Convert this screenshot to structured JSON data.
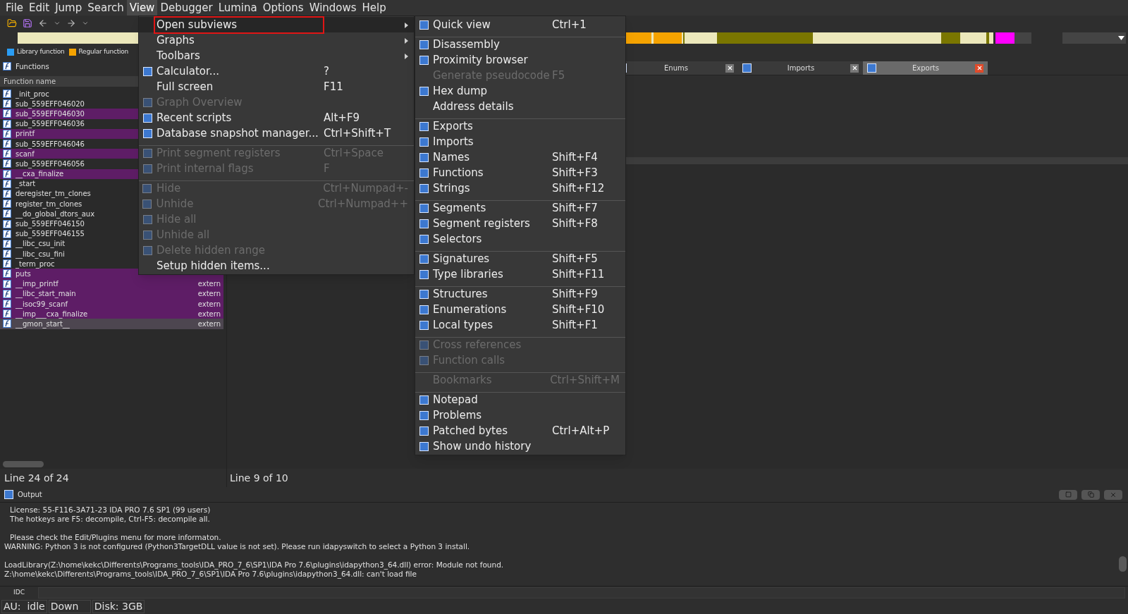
{
  "menubar": [
    {
      "label": "File",
      "selected": false
    },
    {
      "label": "Edit",
      "selected": false
    },
    {
      "label": "Jump",
      "selected": false
    },
    {
      "label": "Search",
      "selected": false
    },
    {
      "label": "View",
      "selected": true
    },
    {
      "label": "Debugger",
      "selected": false
    },
    {
      "label": "Lumina",
      "selected": false
    },
    {
      "label": "Options",
      "selected": false
    },
    {
      "label": "Windows",
      "selected": false
    },
    {
      "label": "Help",
      "selected": false
    }
  ],
  "legend": [
    {
      "label": "Library function",
      "color": "#2a9df4"
    },
    {
      "label": "Regular function",
      "color": "#f5a300"
    }
  ],
  "functions_panel": {
    "title": "Functions",
    "column": "Function name",
    "status": "Line 24 of 24",
    "rows": [
      {
        "name": "_init_proc",
        "kind": "regular",
        "selected": false
      },
      {
        "name": "sub_559EFF046020",
        "kind": "regular",
        "selected": false
      },
      {
        "name": "sub_559EFF046030",
        "kind": "import",
        "selected": false
      },
      {
        "name": "sub_559EFF046036",
        "kind": "regular",
        "selected": false
      },
      {
        "name": "printf",
        "kind": "import",
        "selected": false
      },
      {
        "name": "sub_559EFF046046",
        "kind": "regular",
        "selected": false
      },
      {
        "name": "scanf",
        "kind": "import",
        "selected": false
      },
      {
        "name": "sub_559EFF046056",
        "kind": "regular",
        "selected": false
      },
      {
        "name": "__cxa_finalize",
        "kind": "import",
        "selected": false
      },
      {
        "name": "_start",
        "kind": "regular",
        "selected": false
      },
      {
        "name": "deregister_tm_clones",
        "kind": "regular",
        "selected": false
      },
      {
        "name": "register_tm_clones",
        "kind": "regular",
        "selected": false
      },
      {
        "name": "__do_global_dtors_aux",
        "kind": "regular",
        "selected": false
      },
      {
        "name": "sub_559EFF046150",
        "kind": "regular",
        "selected": false
      },
      {
        "name": "sub_559EFF046155",
        "kind": "regular",
        "selected": false
      },
      {
        "name": "__libc_csu_init",
        "kind": "regular",
        "selected": false
      },
      {
        "name": "__libc_csu_fini",
        "kind": "regular",
        "selected": false
      },
      {
        "name": "_term_proc",
        "kind": "regular",
        "selected": false
      },
      {
        "name": "puts",
        "kind": "import",
        "selected": false
      },
      {
        "name": "__imp_printf",
        "segment": "extern",
        "kind": "import",
        "selected": false
      },
      {
        "name": "__libc_start_main",
        "segment": "extern",
        "kind": "import",
        "selected": false
      },
      {
        "name": "__isoc99_scanf",
        "segment": "extern",
        "kind": "import",
        "selected": false
      },
      {
        "name": "__imp___cxa_finalize",
        "segment": "extern",
        "kind": "import",
        "selected": false
      },
      {
        "name": "__gmon_start__",
        "segment": "extern",
        "kind": "import",
        "selected": true
      }
    ]
  },
  "view_panel": {
    "status": "Line 9 of 10",
    "tabs": [
      {
        "label": "Enums",
        "selected": false
      },
      {
        "label": "Imports",
        "selected": false
      },
      {
        "label": "Exports",
        "selected": true
      }
    ]
  },
  "view_menu": {
    "items": [
      {
        "label": "Open subviews",
        "submenu": true,
        "selected": true,
        "disabled": false,
        "icon": false,
        "separator_before": false
      },
      {
        "label": "Graphs",
        "submenu": true,
        "selected": false,
        "disabled": false,
        "icon": false,
        "separator_before": false
      },
      {
        "label": "Toolbars",
        "submenu": true,
        "selected": false,
        "disabled": false,
        "icon": false,
        "separator_before": false
      },
      {
        "label": "Calculator...",
        "shortcut": "?",
        "submenu": false,
        "selected": false,
        "disabled": false,
        "icon": true,
        "separator_before": false
      },
      {
        "label": "Full screen",
        "shortcut": "F11",
        "submenu": false,
        "selected": false,
        "disabled": false,
        "icon": false,
        "separator_before": false
      },
      {
        "label": "Graph Overview",
        "submenu": false,
        "selected": false,
        "disabled": true,
        "icon": true,
        "separator_before": false
      },
      {
        "label": "Recent scripts",
        "shortcut": "Alt+F9",
        "submenu": false,
        "selected": false,
        "disabled": false,
        "icon": true,
        "separator_before": false
      },
      {
        "label": "Database snapshot manager...",
        "shortcut": "Ctrl+Shift+T",
        "submenu": false,
        "selected": false,
        "disabled": false,
        "icon": true,
        "separator_before": false
      },
      {
        "label": "Print segment registers",
        "shortcut": "Ctrl+Space",
        "submenu": false,
        "selected": false,
        "disabled": true,
        "icon": true,
        "separator_before": true
      },
      {
        "label": "Print internal flags",
        "shortcut": "F",
        "submenu": false,
        "selected": false,
        "disabled": true,
        "icon": true,
        "separator_before": false
      },
      {
        "label": "Hide",
        "shortcut": "Ctrl+Numpad+-",
        "submenu": false,
        "selected": false,
        "disabled": true,
        "icon": true,
        "separator_before": true
      },
      {
        "label": "Unhide",
        "shortcut": "Ctrl+Numpad++",
        "submenu": false,
        "selected": false,
        "disabled": true,
        "icon": true,
        "separator_before": false
      },
      {
        "label": "Hide all",
        "submenu": false,
        "selected": false,
        "disabled": true,
        "icon": true,
        "separator_before": false
      },
      {
        "label": "Unhide all",
        "submenu": false,
        "selected": false,
        "disabled": true,
        "icon": true,
        "separator_before": false
      },
      {
        "label": "Delete hidden range",
        "submenu": false,
        "selected": false,
        "disabled": true,
        "icon": true,
        "separator_before": false
      },
      {
        "label": "Setup hidden items...",
        "submenu": false,
        "selected": false,
        "disabled": false,
        "icon": false,
        "separator_before": false
      }
    ]
  },
  "subviews_menu": {
    "items": [
      {
        "label": "Quick view",
        "shortcut": "Ctrl+1",
        "disabled": false,
        "icon": true,
        "separator_before": false
      },
      {
        "label": "Disassembly",
        "disabled": false,
        "icon": true,
        "separator_before": true
      },
      {
        "label": "Proximity browser",
        "disabled": false,
        "icon": true,
        "separator_before": false
      },
      {
        "label": "Generate pseudocode",
        "shortcut": "F5",
        "disabled": true,
        "icon": false,
        "separator_before": false
      },
      {
        "label": "Hex dump",
        "disabled": false,
        "icon": true,
        "separator_before": false
      },
      {
        "label": "Address details",
        "disabled": false,
        "icon": false,
        "separator_before": false
      },
      {
        "label": "Exports",
        "disabled": false,
        "icon": true,
        "separator_before": true
      },
      {
        "label": "Imports",
        "disabled": false,
        "icon": true,
        "separator_before": false
      },
      {
        "label": "Names",
        "shortcut": "Shift+F4",
        "disabled": false,
        "icon": true,
        "separator_before": false
      },
      {
        "label": "Functions",
        "shortcut": "Shift+F3",
        "disabled": false,
        "icon": true,
        "separator_before": false
      },
      {
        "label": "Strings",
        "shortcut": "Shift+F12",
        "disabled": false,
        "icon": true,
        "separator_before": false
      },
      {
        "label": "Segments",
        "shortcut": "Shift+F7",
        "disabled": false,
        "icon": true,
        "separator_before": true
      },
      {
        "label": "Segment registers",
        "shortcut": "Shift+F8",
        "disabled": false,
        "icon": true,
        "separator_before": false
      },
      {
        "label": "Selectors",
        "disabled": false,
        "icon": true,
        "separator_before": false
      },
      {
        "label": "Signatures",
        "shortcut": "Shift+F5",
        "disabled": false,
        "icon": true,
        "separator_before": true
      },
      {
        "label": "Type libraries",
        "shortcut": "Shift+F11",
        "disabled": false,
        "icon": true,
        "separator_before": false
      },
      {
        "label": "Structures",
        "shortcut": "Shift+F9",
        "disabled": false,
        "icon": true,
        "separator_before": true
      },
      {
        "label": "Enumerations",
        "shortcut": "Shift+F10",
        "disabled": false,
        "icon": true,
        "separator_before": false
      },
      {
        "label": "Local types",
        "shortcut": "Shift+F1",
        "disabled": false,
        "icon": true,
        "separator_before": false
      },
      {
        "label": "Cross references",
        "disabled": true,
        "icon": true,
        "separator_before": true
      },
      {
        "label": "Function calls",
        "disabled": true,
        "icon": true,
        "separator_before": false
      },
      {
        "label": "Bookmarks",
        "shortcut": "Ctrl+Shift+M",
        "disabled": true,
        "icon": false,
        "separator_before": true
      },
      {
        "label": "Notepad",
        "disabled": false,
        "icon": true,
        "separator_before": true
      },
      {
        "label": "Problems",
        "disabled": false,
        "icon": true,
        "separator_before": false
      },
      {
        "label": "Patched bytes",
        "shortcut": "Ctrl+Alt+P",
        "disabled": false,
        "icon": true,
        "separator_before": false
      },
      {
        "label": "Show undo history",
        "disabled": false,
        "icon": true,
        "separator_before": false
      }
    ]
  },
  "output": {
    "title": "Output",
    "lines": [
      {
        "text": "License: 55-F116-3A71-23 IDA PRO 7.6 SP1 (99 users)",
        "indented": true,
        "gap_before": false
      },
      {
        "text": "The hotkeys are F5: decompile, Ctrl-F5: decompile all.",
        "indented": true,
        "gap_before": false
      },
      {
        "text": "Please check the Edit/Plugins menu for more informaton.",
        "indented": true,
        "gap_before": true
      },
      {
        "text": "WARNING: Python 3 is not configured (Python3TargetDLL value is not set). Please run idapyswitch to select a Python 3 install.",
        "indented": false,
        "gap_before": false
      },
      {
        "text": "LoadLibrary(Z:\\home\\kekc\\Differents\\Programs_tools\\IDA_PRO_7_6\\SP1\\IDA Pro 7.6\\plugins\\idapython3_64.dll) error: Module not found.",
        "indented": false,
        "gap_before": true
      },
      {
        "text": "Z:\\home\\kekc\\Differents\\Programs_tools\\IDA_PRO_7_6\\SP1\\IDA Pro 7.6\\plugins\\idapython3_64.dll: can't load file",
        "indented": false,
        "gap_before": false
      }
    ]
  },
  "idc": {
    "label": "IDC"
  },
  "status_bar": [
    "AU:  idle",
    "Down",
    "Disk: 3GB"
  ]
}
